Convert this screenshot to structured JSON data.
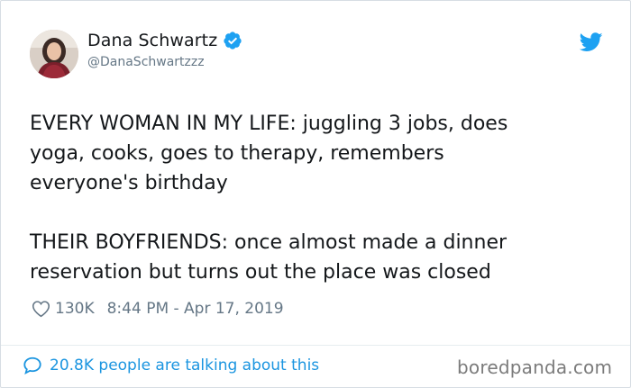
{
  "author": {
    "display_name": "Dana Schwartz",
    "handle": "@DanaSchwartzzz",
    "verified": true
  },
  "tweet": {
    "paragraph_1_line_1": "EVERY WOMAN IN MY LIFE: juggling 3 jobs, does",
    "paragraph_1_line_2": "yoga, cooks, goes to therapy, remembers",
    "paragraph_1_line_3": "everyone's birthday",
    "paragraph_2_line_1": "THEIR BOYFRIENDS: once almost made a dinner",
    "paragraph_2_line_2": "reservation but turns out the place was closed"
  },
  "meta": {
    "likes": "130K",
    "timestamp": "8:44 PM - Apr 17, 2019"
  },
  "footer": {
    "talking": "20.8K people are talking about this",
    "watermark": "boredpanda.com"
  },
  "icons": {
    "verified": "verified-badge-icon",
    "brand": "twitter-bird-icon",
    "like": "heart-icon",
    "reply": "speech-bubble-icon"
  },
  "colors": {
    "twitter_blue": "#1da1f2",
    "link_blue": "#1b95e0",
    "secondary_text": "#657786"
  }
}
